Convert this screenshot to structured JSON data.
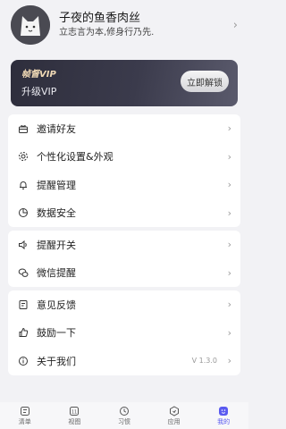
{
  "profile": {
    "name": "子夜的鱼香肉丝",
    "motto": "立志言为本,修身行乃先."
  },
  "vip": {
    "title": "帧督VIP",
    "subtitle": "升级VIP",
    "button": "立即解锁"
  },
  "menu_group1": [
    {
      "label": "邀请好友",
      "icon": "gift-icon"
    },
    {
      "label": "个性化设置&外观",
      "icon": "gear-icon"
    },
    {
      "label": "提醒管理",
      "icon": "bell-icon"
    },
    {
      "label": "数据安全",
      "icon": "pie-chart-icon"
    }
  ],
  "menu_group2": [
    {
      "label": "提醒开关",
      "icon": "speaker-icon"
    },
    {
      "label": "微信提醒",
      "icon": "wechat-icon"
    }
  ],
  "menu_group3": [
    {
      "label": "意见反馈",
      "icon": "edit-note-icon"
    },
    {
      "label": "鼓励一下",
      "icon": "thumb-icon"
    },
    {
      "label": "关于我们",
      "icon": "info-icon",
      "extra": "V 1.3.0"
    }
  ],
  "tabs": [
    {
      "label": "清单",
      "icon": "list-icon"
    },
    {
      "label": "视图",
      "icon": "calendar-icon",
      "icon_text": "11"
    },
    {
      "label": "习惯",
      "icon": "clock-icon"
    },
    {
      "label": "应用",
      "icon": "apps-icon"
    },
    {
      "label": "我的",
      "icon": "user-face-icon",
      "active": true
    }
  ],
  "colors": {
    "accent": "#5a5af0",
    "vip_gold": "#f0d9b5",
    "background": "#f2f2f5"
  }
}
